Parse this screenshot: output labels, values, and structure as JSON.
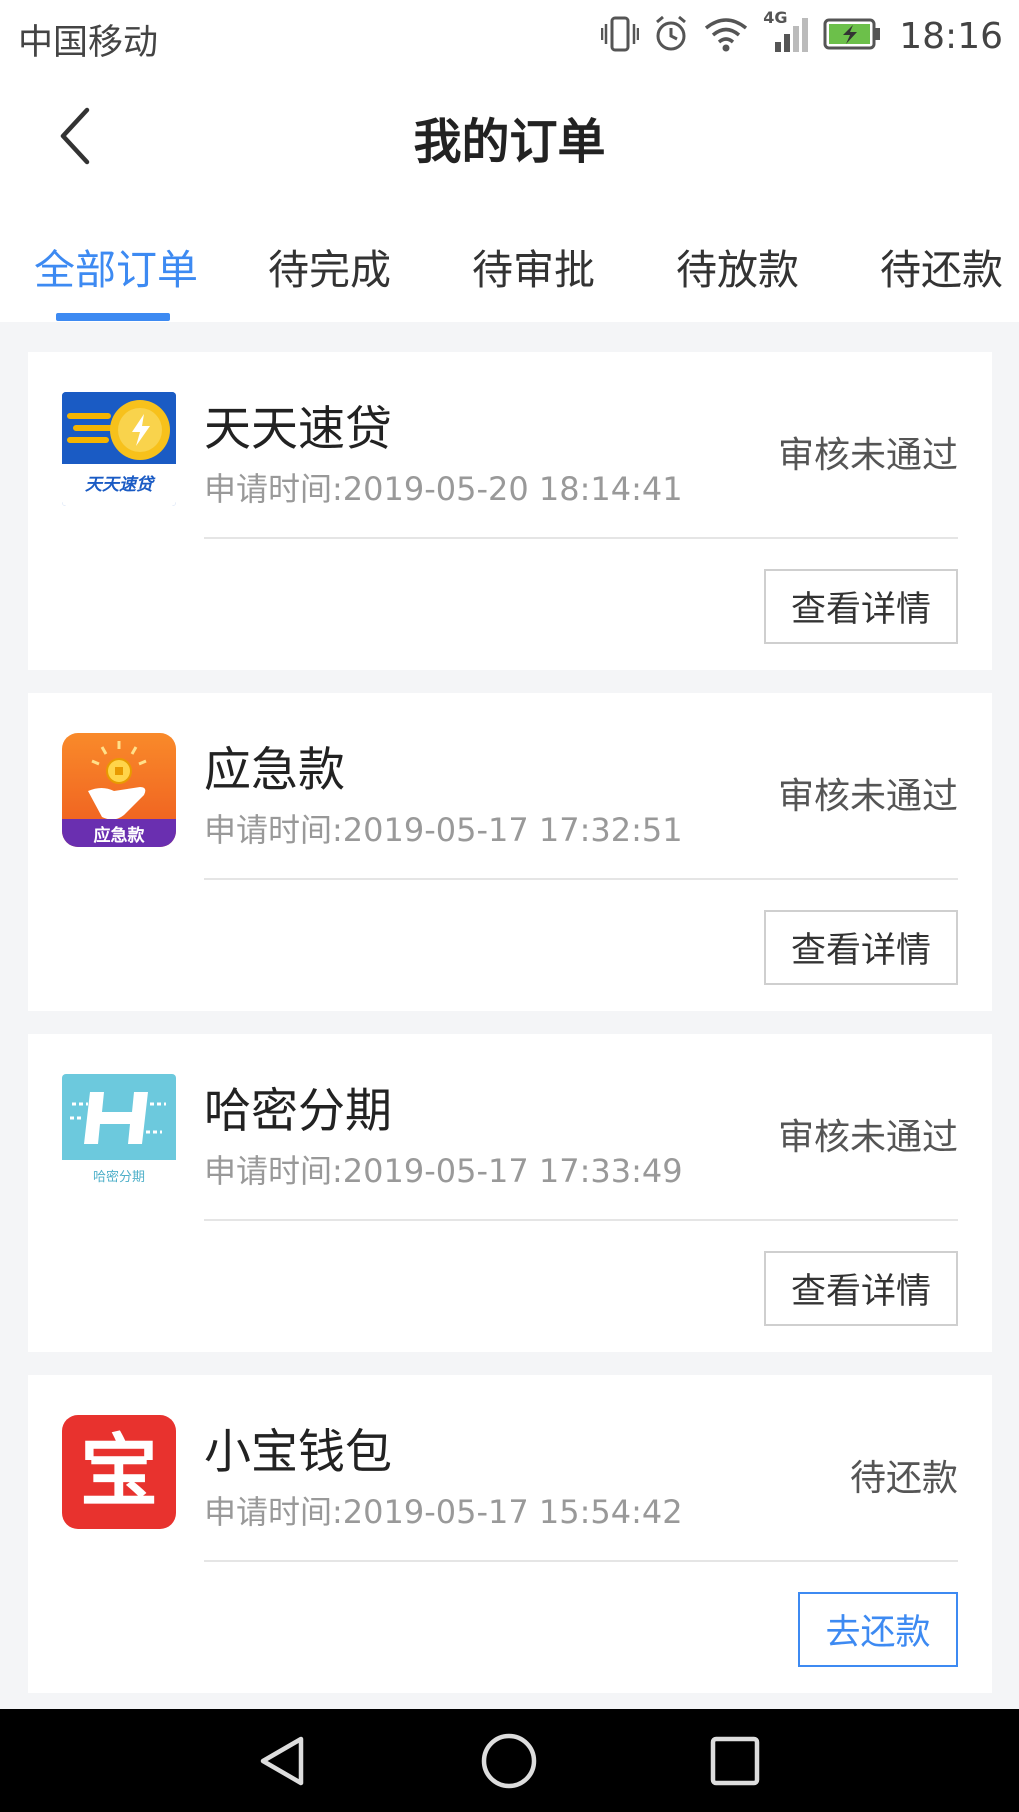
{
  "status_bar": {
    "carrier": "中国移动",
    "network": "4G",
    "time": "18:16"
  },
  "header": {
    "title": "我的订单"
  },
  "tabs": [
    {
      "label": "全部订单",
      "active": true
    },
    {
      "label": "待完成",
      "active": false
    },
    {
      "label": "待审批",
      "active": false
    },
    {
      "label": "待放款",
      "active": false
    },
    {
      "label": "待还款",
      "active": false
    }
  ],
  "orders": [
    {
      "name": "天天速贷",
      "time": "申请时间:2019-05-20 18:14:41",
      "status": "审核未通过",
      "action": "查看详情",
      "logo_text": "天天速贷",
      "logo_icon": "coin-icon"
    },
    {
      "name": "应急款",
      "time": "申请时间:2019-05-17 17:32:51",
      "status": "审核未通过",
      "action": "查看详情",
      "logo_text": "应急款",
      "logo_icon": "coin-hand-icon"
    },
    {
      "name": "哈密分期",
      "time": "申请时间:2019-05-17 17:33:49",
      "status": "审核未通过",
      "action": "查看详情",
      "logo_text": "哈密分期",
      "logo_icon": "h-letter-icon"
    },
    {
      "name": "小宝钱包",
      "time": "申请时间:2019-05-17 15:54:42",
      "status": "待还款",
      "action": "去还款",
      "logo_text": "宝",
      "logo_icon": "bao-char-icon"
    }
  ],
  "colors": {
    "accent": "#3d8af2",
    "background": "#f4f5f7",
    "nav_bar": "#000000"
  },
  "icons": {
    "back": "chevron-left-icon",
    "nav_back": "triangle-back-icon",
    "nav_home": "circle-home-icon",
    "nav_recents": "square-recents-icon"
  }
}
